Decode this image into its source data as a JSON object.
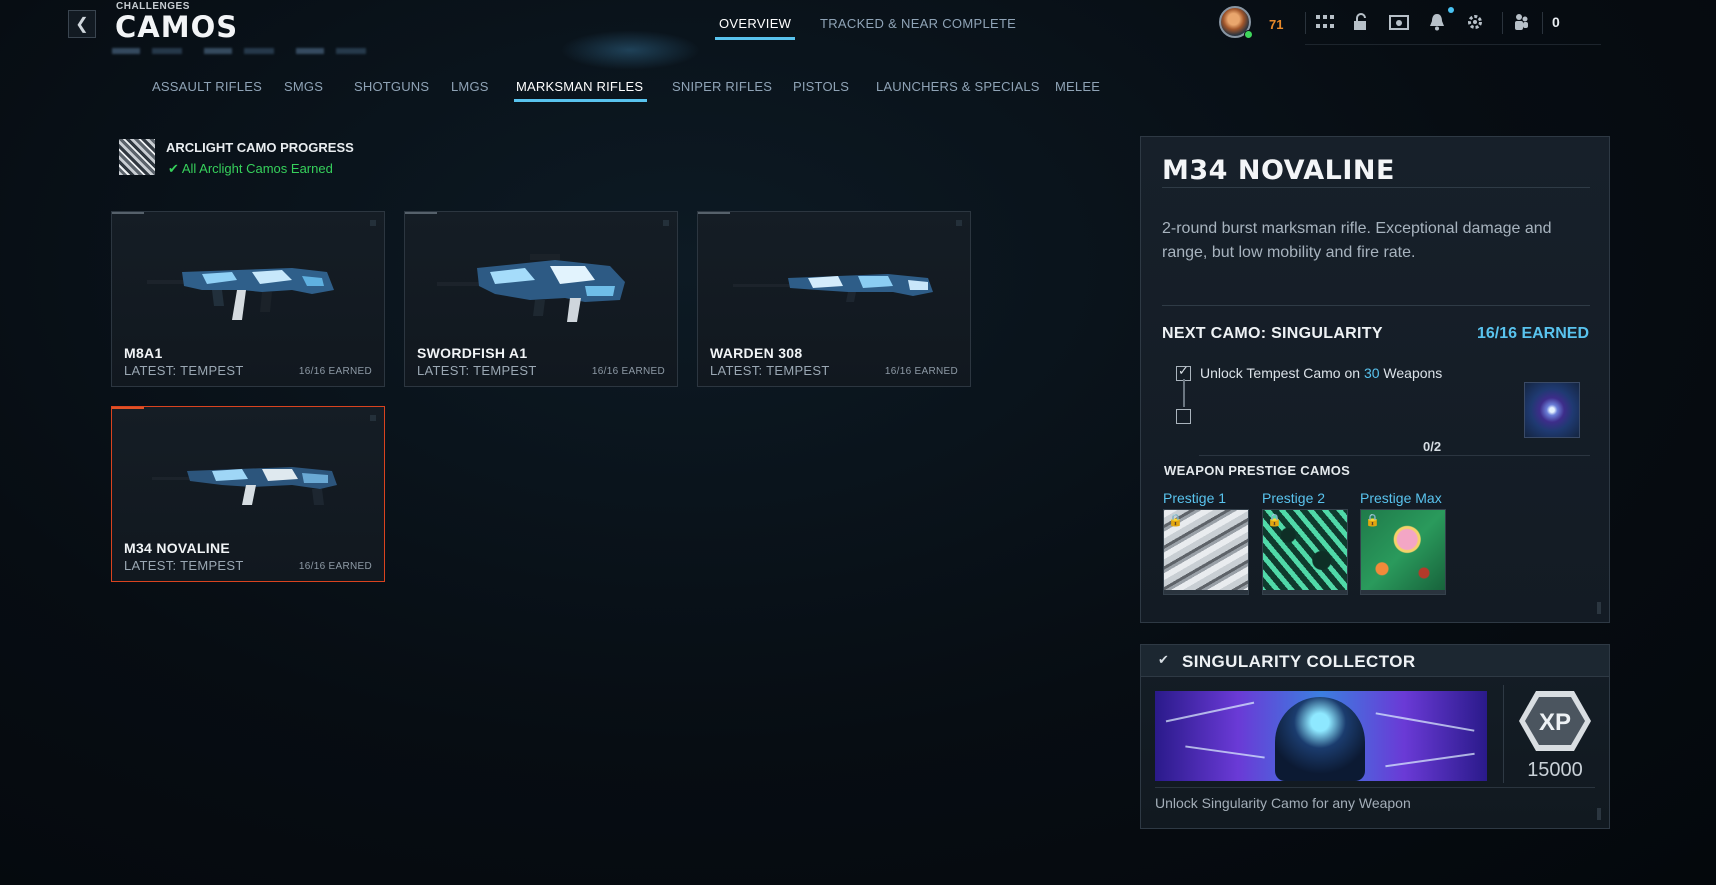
{
  "header": {
    "breadcrumb": "CHALLENGES",
    "title": "CAMOS",
    "tabs": [
      {
        "label": "OVERVIEW",
        "active": true
      },
      {
        "label": "TRACKED & NEAR COMPLETE",
        "active": false
      }
    ],
    "player_level": "71",
    "friends_count": "0",
    "icons": [
      "grid-icon",
      "unlock-icon",
      "store-icon",
      "bell-icon",
      "gear-icon",
      "friends-icon"
    ],
    "accent_color": "#59c3ee",
    "level_color": "#e8892a"
  },
  "categories": [
    {
      "label": "ASSAULT RIFLES",
      "active": false
    },
    {
      "label": "SMGS",
      "active": false
    },
    {
      "label": "SHOTGUNS",
      "active": false
    },
    {
      "label": "LMGS",
      "active": false
    },
    {
      "label": "MARKSMAN RIFLES",
      "active": true
    },
    {
      "label": "SNIPER RIFLES",
      "active": false
    },
    {
      "label": "PISTOLS",
      "active": false
    },
    {
      "label": "LAUNCHERS & SPECIALS",
      "active": false
    },
    {
      "label": "MELEE",
      "active": false
    }
  ],
  "arclight": {
    "title": "ARCLIGHT CAMO PROGRESS",
    "status": "All Arclight Camos Earned",
    "status_color": "#36d05b"
  },
  "weapons": [
    {
      "name": "M8A1",
      "latest": "LATEST: TEMPEST",
      "earned": "16/16 EARNED",
      "selected": false
    },
    {
      "name": "SWORDFISH A1",
      "latest": "LATEST: TEMPEST",
      "earned": "16/16 EARNED",
      "selected": false
    },
    {
      "name": "WARDEN 308",
      "latest": "LATEST: TEMPEST",
      "earned": "16/16 EARNED",
      "selected": false
    },
    {
      "name": "M34 NOVALINE",
      "latest": "LATEST: TEMPEST",
      "earned": "16/16 EARNED",
      "selected": true
    }
  ],
  "detail": {
    "name": "M34 NOVALINE",
    "description": "2-round burst marksman rifle. Exceptional damage and range, but low mobility and fire rate.",
    "next_camo_label": "NEXT CAMO: SINGULARITY",
    "next_camo_earned": "16/16 EARNED",
    "requirement_prefix": "Unlock Tempest Camo on ",
    "requirement_count": "30",
    "requirement_suffix": " Weapons",
    "requirement_checked": true,
    "progress": "0/2",
    "prestige_heading": "WEAPON PRESTIGE CAMOS",
    "prestige": [
      {
        "label": "Prestige 1",
        "locked": true
      },
      {
        "label": "Prestige 2",
        "locked": true
      },
      {
        "label": "Prestige Max",
        "locked": true
      }
    ]
  },
  "collector": {
    "title": "SINGULARITY COLLECTOR",
    "completed": true,
    "xp_label": "XP",
    "xp_value": "15000",
    "description": "Unlock Singularity Camo for any Weapon"
  }
}
